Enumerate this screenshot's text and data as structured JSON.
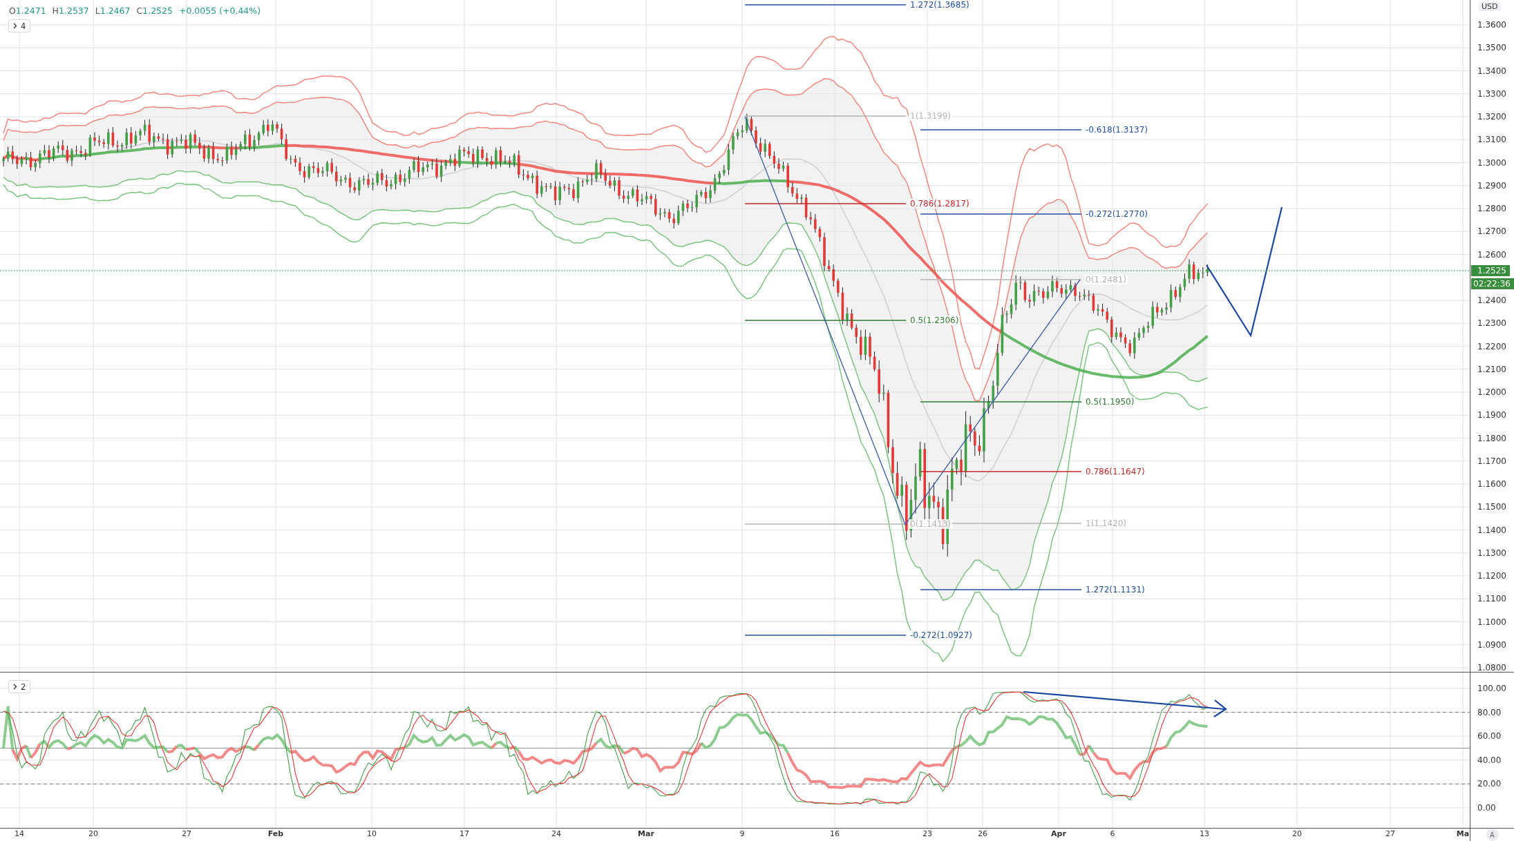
{
  "legend": {
    "values": [
      {
        "label": "O",
        "value": "1.2471"
      },
      {
        "label": "H",
        "value": "1.2537"
      },
      {
        "label": "L",
        "value": "1.2467"
      },
      {
        "label": "C",
        "value": "1.2525"
      }
    ],
    "change": "+0.0055 (+0.44%)"
  },
  "main_pane": {
    "indicator_count": "4",
    "fib_labels": [
      {
        "text": "1.272(1.3685)",
        "color": "#2350a5"
      },
      {
        "text": "1(1.3199)",
        "color": "#b4b4b4"
      },
      {
        "text": "-0.618(1.3137)",
        "color": "#2350a5"
      },
      {
        "text": "0.786(1.2817)",
        "color": "#c62828"
      },
      {
        "text": "-0.272(1.2770)",
        "color": "#2350a5"
      },
      {
        "text": "0(1.2481)",
        "color": "#b4b4b4"
      },
      {
        "text": "0.5(1.2306)",
        "color": "#2e7d32"
      },
      {
        "text": "0.5(1.1950)",
        "color": "#2e7d32"
      },
      {
        "text": "0.786(1.1647)",
        "color": "#c62828"
      },
      {
        "text": "0(1.1413)",
        "color": "#b4b4b4"
      },
      {
        "text": "1(1.1420)",
        "color": "#b4b4b4"
      },
      {
        "text": "1.272(1.1131)",
        "color": "#2350a5"
      },
      {
        "text": "-0.272(1.0927)",
        "color": "#2350a5"
      }
    ]
  },
  "price_axis": {
    "currency": "USD",
    "ticks": [
      "1.3600",
      "1.3500",
      "1.3400",
      "1.3300",
      "1.3200",
      "1.3100",
      "1.3000",
      "1.2900",
      "1.2800",
      "1.2700",
      "1.2600",
      "1.2400",
      "1.2300",
      "1.2200",
      "1.2100",
      "1.2000",
      "1.1900",
      "1.1800",
      "1.1700",
      "1.1600",
      "1.1500",
      "1.1400",
      "1.1300",
      "1.1200",
      "1.1100",
      "1.1000",
      "1.0900",
      "1.0800"
    ],
    "current_price": "1.2525",
    "countdown": "02:22:36"
  },
  "oscillator_pane": {
    "indicator_count": "2",
    "ticks": [
      "100.00",
      "80.00",
      "60.00",
      "40.00",
      "20.00",
      "0.00"
    ]
  },
  "time_axis": {
    "labels": [
      {
        "text": "14",
        "kind": "day"
      },
      {
        "text": "20",
        "kind": "day"
      },
      {
        "text": "27",
        "kind": "day"
      },
      {
        "text": "Feb",
        "kind": "month"
      },
      {
        "text": "10",
        "kind": "day"
      },
      {
        "text": "17",
        "kind": "day"
      },
      {
        "text": "24",
        "kind": "day"
      },
      {
        "text": "Mar",
        "kind": "month"
      },
      {
        "text": "9",
        "kind": "day"
      },
      {
        "text": "16",
        "kind": "day"
      },
      {
        "text": "23",
        "kind": "day"
      },
      {
        "text": "26",
        "kind": "day"
      },
      {
        "text": "Apr",
        "kind": "month"
      },
      {
        "text": "6",
        "kind": "day"
      },
      {
        "text": "13",
        "kind": "day"
      },
      {
        "text": "20",
        "kind": "day"
      },
      {
        "text": "27",
        "kind": "day"
      },
      {
        "text": "Ma",
        "kind": "month"
      }
    ]
  },
  "auto_scale_button": "A"
}
